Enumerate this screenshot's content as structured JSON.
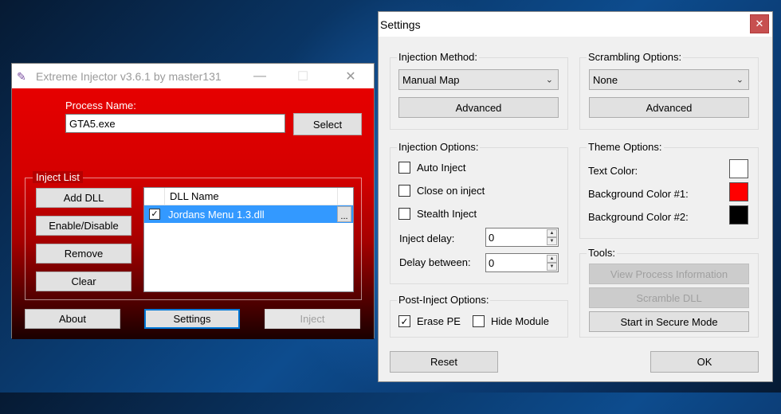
{
  "injector": {
    "title": "Extreme Injector v3.6.1 by master131",
    "process_label": "Process Name:",
    "process_value": "GTA5.exe",
    "select_label": "Select",
    "inject_list_label": "Inject List",
    "buttons": {
      "add": "Add DLL",
      "toggle": "Enable/Disable",
      "remove": "Remove",
      "clear": "Clear"
    },
    "list": {
      "header": "DLL Name",
      "rows": [
        {
          "name": "Jordans Menu 1.3.dll",
          "checked": true,
          "more": "..."
        }
      ]
    },
    "bottom": {
      "about": "About",
      "settings": "Settings",
      "inject": "Inject"
    },
    "window_controls": {
      "minimize": "—",
      "maximize": "☐",
      "close": "✕"
    }
  },
  "settings": {
    "title": "Settings",
    "close": "✕",
    "injection_method": {
      "label": "Injection Method:",
      "value": "Manual Map",
      "advanced": "Advanced"
    },
    "scrambling": {
      "label": "Scrambling Options:",
      "value": "None",
      "advanced": "Advanced"
    },
    "injection_options": {
      "label": "Injection Options:",
      "auto_inject": "Auto Inject",
      "close_on_inject": "Close on inject",
      "stealth_inject": "Stealth Inject",
      "inject_delay_label": "Inject delay:",
      "inject_delay_value": "0",
      "delay_between_label": "Delay between:",
      "delay_between_value": "0"
    },
    "post_inject": {
      "label": "Post-Inject Options:",
      "erase_pe": "Erase PE",
      "erase_pe_checked": true,
      "hide_module": "Hide Module",
      "hide_module_checked": false
    },
    "theme": {
      "label": "Theme Options:",
      "text_color_label": "Text Color:",
      "text_color": "#ffffff",
      "bg1_label": "Background Color #1:",
      "bg1": "#ff0000",
      "bg2_label": "Background Color #2:",
      "bg2": "#000000"
    },
    "tools": {
      "label": "Tools:",
      "view_process": "View Process Information",
      "scramble_dll": "Scramble DLL",
      "secure_mode": "Start in Secure Mode"
    },
    "reset": "Reset",
    "ok": "OK"
  },
  "icons": {
    "app": "syringe-icon",
    "combo": "chevron-down-icon",
    "check": "✓"
  }
}
